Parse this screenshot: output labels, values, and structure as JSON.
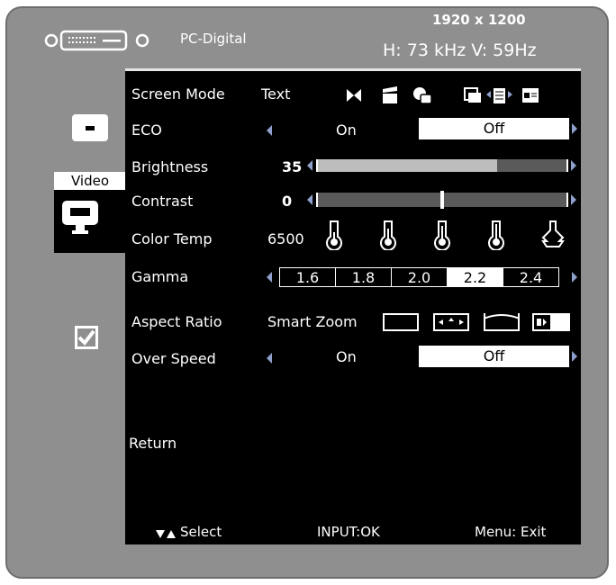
{
  "header": {
    "source": "PC-Digital",
    "resolution": "1920 x 1200",
    "frequency": "H: 73 kHz  V: 59Hz"
  },
  "sidebar": {
    "active_label": "Video"
  },
  "menu": {
    "screen_mode": {
      "label": "Screen Mode",
      "value": "Text"
    },
    "eco": {
      "label": "ECO",
      "on": "On",
      "off": "Off"
    },
    "brightness": {
      "label": "Brightness",
      "value": "35",
      "level": 0.87
    },
    "contrast": {
      "label": "Contrast",
      "value": "0",
      "level": 0.5
    },
    "color_temp": {
      "label": "Color Temp",
      "value": "6500"
    },
    "gamma": {
      "label": "Gamma",
      "options": [
        "1.6",
        "1.8",
        "2.0",
        "2.2",
        "2.4"
      ],
      "selected": "2.2"
    },
    "aspect_ratio": {
      "label": "Aspect Ratio",
      "value": "Smart Zoom"
    },
    "over_speed": {
      "label": "Over Speed",
      "on": "On",
      "off": "Off"
    },
    "return_label": "Return"
  },
  "footer": {
    "select_label": "Select",
    "input_label": "INPUT:OK",
    "menu_label": "Menu: Exit"
  },
  "colors": {
    "frame": "#8f8f8f",
    "panel": "#000000",
    "arrow": "#8fa0cc",
    "slider_fill": "#bdbdbd",
    "slider_track": "#5a5a5a"
  }
}
